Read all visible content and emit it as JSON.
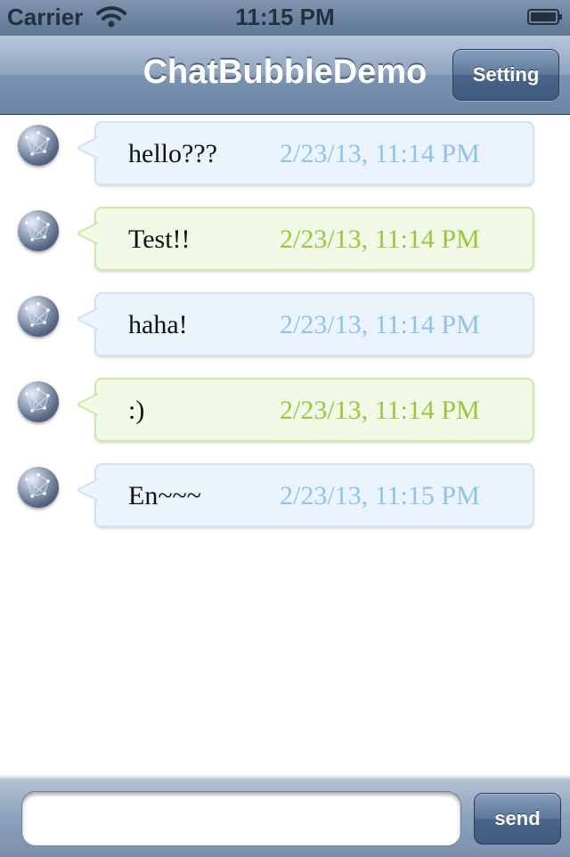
{
  "status_bar": {
    "carrier": "Carrier",
    "time": "11:15 PM",
    "wifi_icon": "wifi-icon",
    "battery_icon": "battery-icon"
  },
  "nav_bar": {
    "title": "ChatBubbleDemo",
    "setting_label": "Setting"
  },
  "messages": [
    {
      "text": "hello???",
      "time": "2/23/13, 11:14 PM",
      "bubble_color": "blue"
    },
    {
      "text": "Test!!",
      "time": "2/23/13, 11:14 PM",
      "bubble_color": "green"
    },
    {
      "text": "haha!",
      "time": "2/23/13, 11:14 PM",
      "bubble_color": "blue"
    },
    {
      "text": ":)",
      "time": "2/23/13, 11:14 PM",
      "bubble_color": "green"
    },
    {
      "text": "En~~~",
      "time": "2/23/13, 11:15 PM",
      "bubble_color": "blue"
    }
  ],
  "input_bar": {
    "input_value": "",
    "input_placeholder": "",
    "send_label": "send"
  },
  "colors": {
    "blue_bubble_bg": "#ebf4fd",
    "blue_time": "#8dc3ec",
    "green_bubble_bg": "#f2f9e6",
    "green_time": "#98c741",
    "nav_bar": "#8ea3bf"
  }
}
